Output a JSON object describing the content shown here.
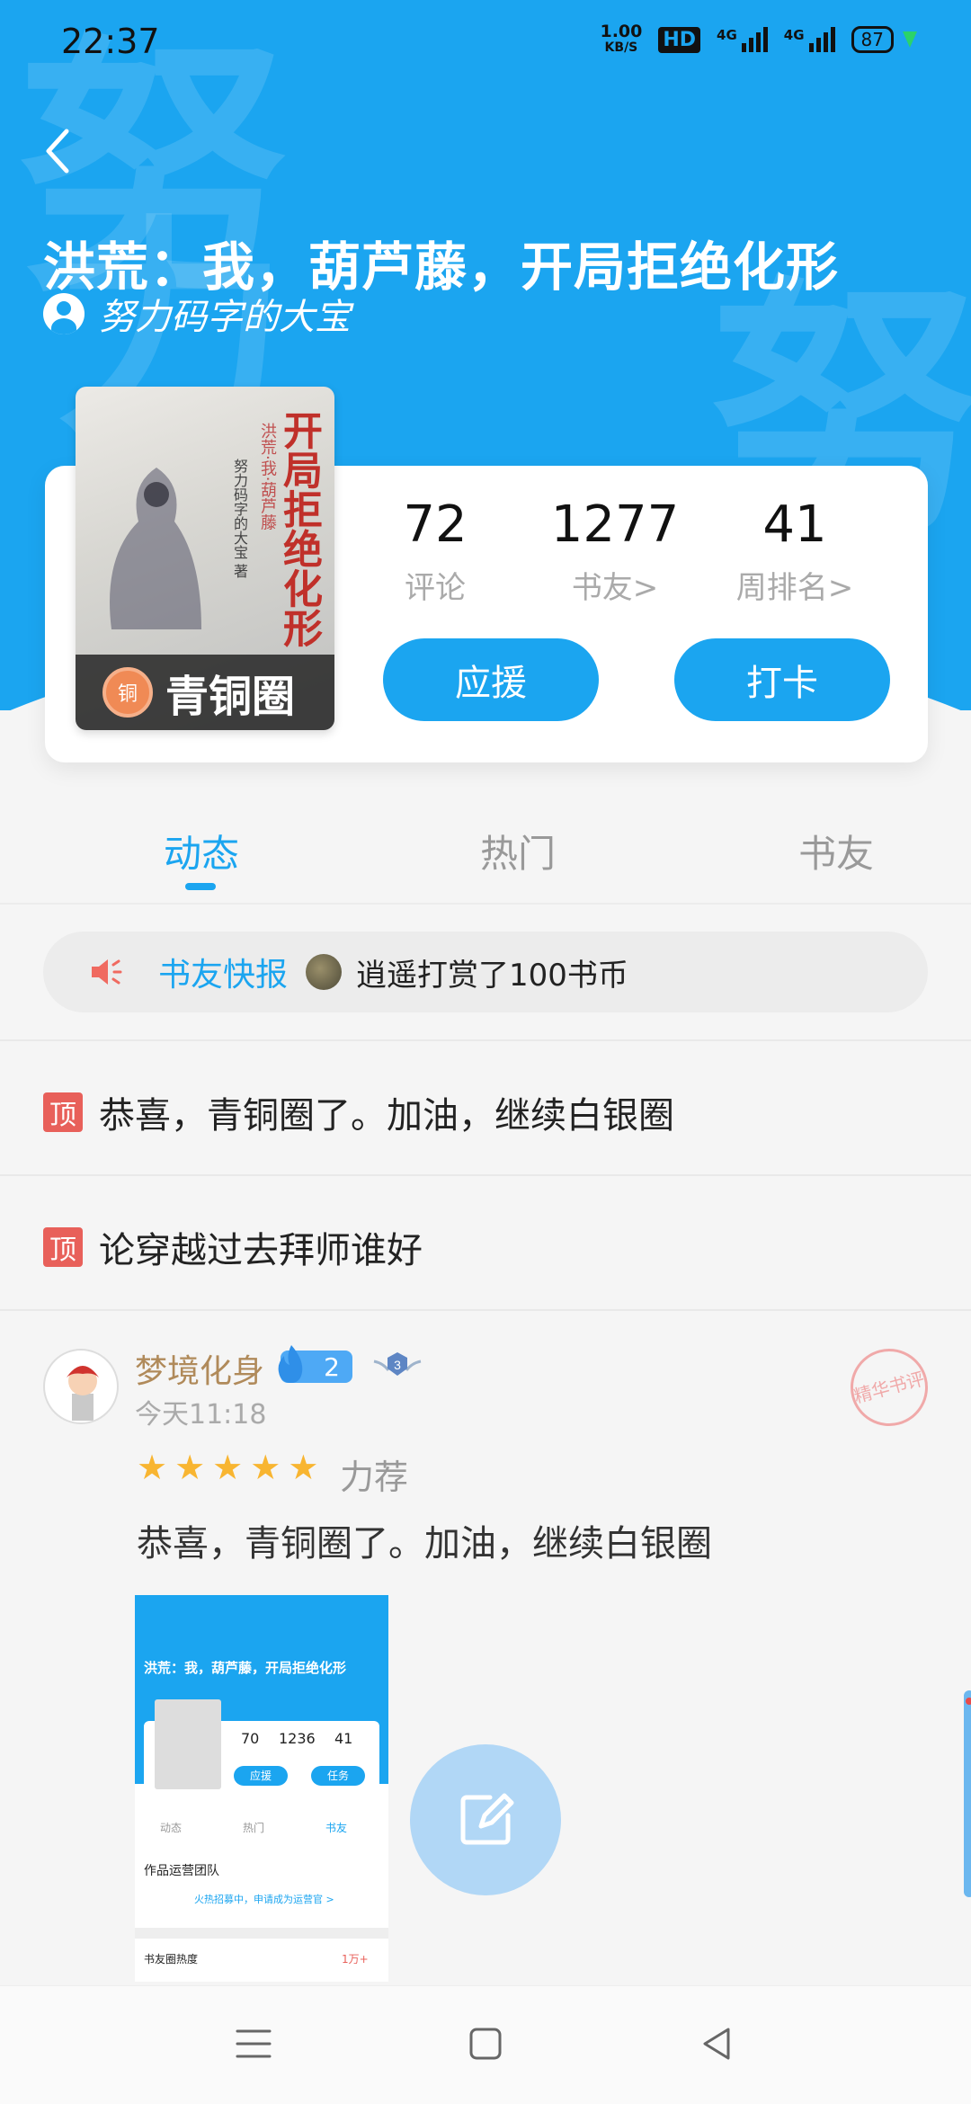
{
  "status_bar": {
    "time": "22:37",
    "speed_value": "1.00",
    "speed_unit": "KB/S",
    "hd": "HD",
    "net1": "4G",
    "net2": "4G",
    "battery": "87"
  },
  "header": {
    "title": "洪荒：我，葫芦藤，开局拒绝化形",
    "author": "努力码字的大宝",
    "watermark": "努"
  },
  "cover": {
    "title": "开局拒绝化形",
    "subtitle": "洪荒·我·葫芦藤",
    "author": "努力码字的大宝 著",
    "badge_char": "铜",
    "badge_label": "青铜圈"
  },
  "stats": [
    {
      "value": "72",
      "label": "评论"
    },
    {
      "value": "1277",
      "label": "书友>"
    },
    {
      "value": "41",
      "label": "周排名>"
    }
  ],
  "actions": {
    "support": "应援",
    "checkin": "打卡"
  },
  "tabs": [
    {
      "label": "动态",
      "active": true
    },
    {
      "label": "热门",
      "active": false
    },
    {
      "label": "书友",
      "active": false
    }
  ],
  "news": {
    "label": "书友快报",
    "text": "逍遥打赏了100书币"
  },
  "pinned": [
    {
      "tag": "顶",
      "text": "恭喜，青铜圈了。加油，继续白银圈"
    },
    {
      "tag": "顶",
      "text": "论穿越过去拜师谁好"
    }
  ],
  "post": {
    "user": "梦境化身",
    "level": "2",
    "rank": "3",
    "time": "今天11:18",
    "stamp": "精华书评",
    "rating": 5,
    "rating_label": "力荐",
    "body": "恭喜，青铜圈了。加油，继续白银圈",
    "thumb": {
      "title": "洪荒：我，葫芦藤，开局拒绝化形",
      "stat1": "70",
      "stat2": "1236",
      "stat3": "41",
      "btn1": "应援",
      "btn2": "任务",
      "tab1": "动态",
      "tab2": "热门",
      "tab3": "书友",
      "team": "作品运营团队",
      "recruit": "火热招募中，申请成为运营官 >",
      "heat": "书友圈热度",
      "heat_rank": "1万+"
    }
  },
  "colors": {
    "brand": "#1ba5f0",
    "pin": "#e8605a",
    "star": "#f8b531",
    "username": "#b08a5a"
  },
  "icons": {
    "back": "chevron-left-icon",
    "news": "speaker-icon",
    "fab": "edit-icon",
    "nav": [
      "menu-icon",
      "home-square-icon",
      "back-triangle-icon"
    ]
  }
}
